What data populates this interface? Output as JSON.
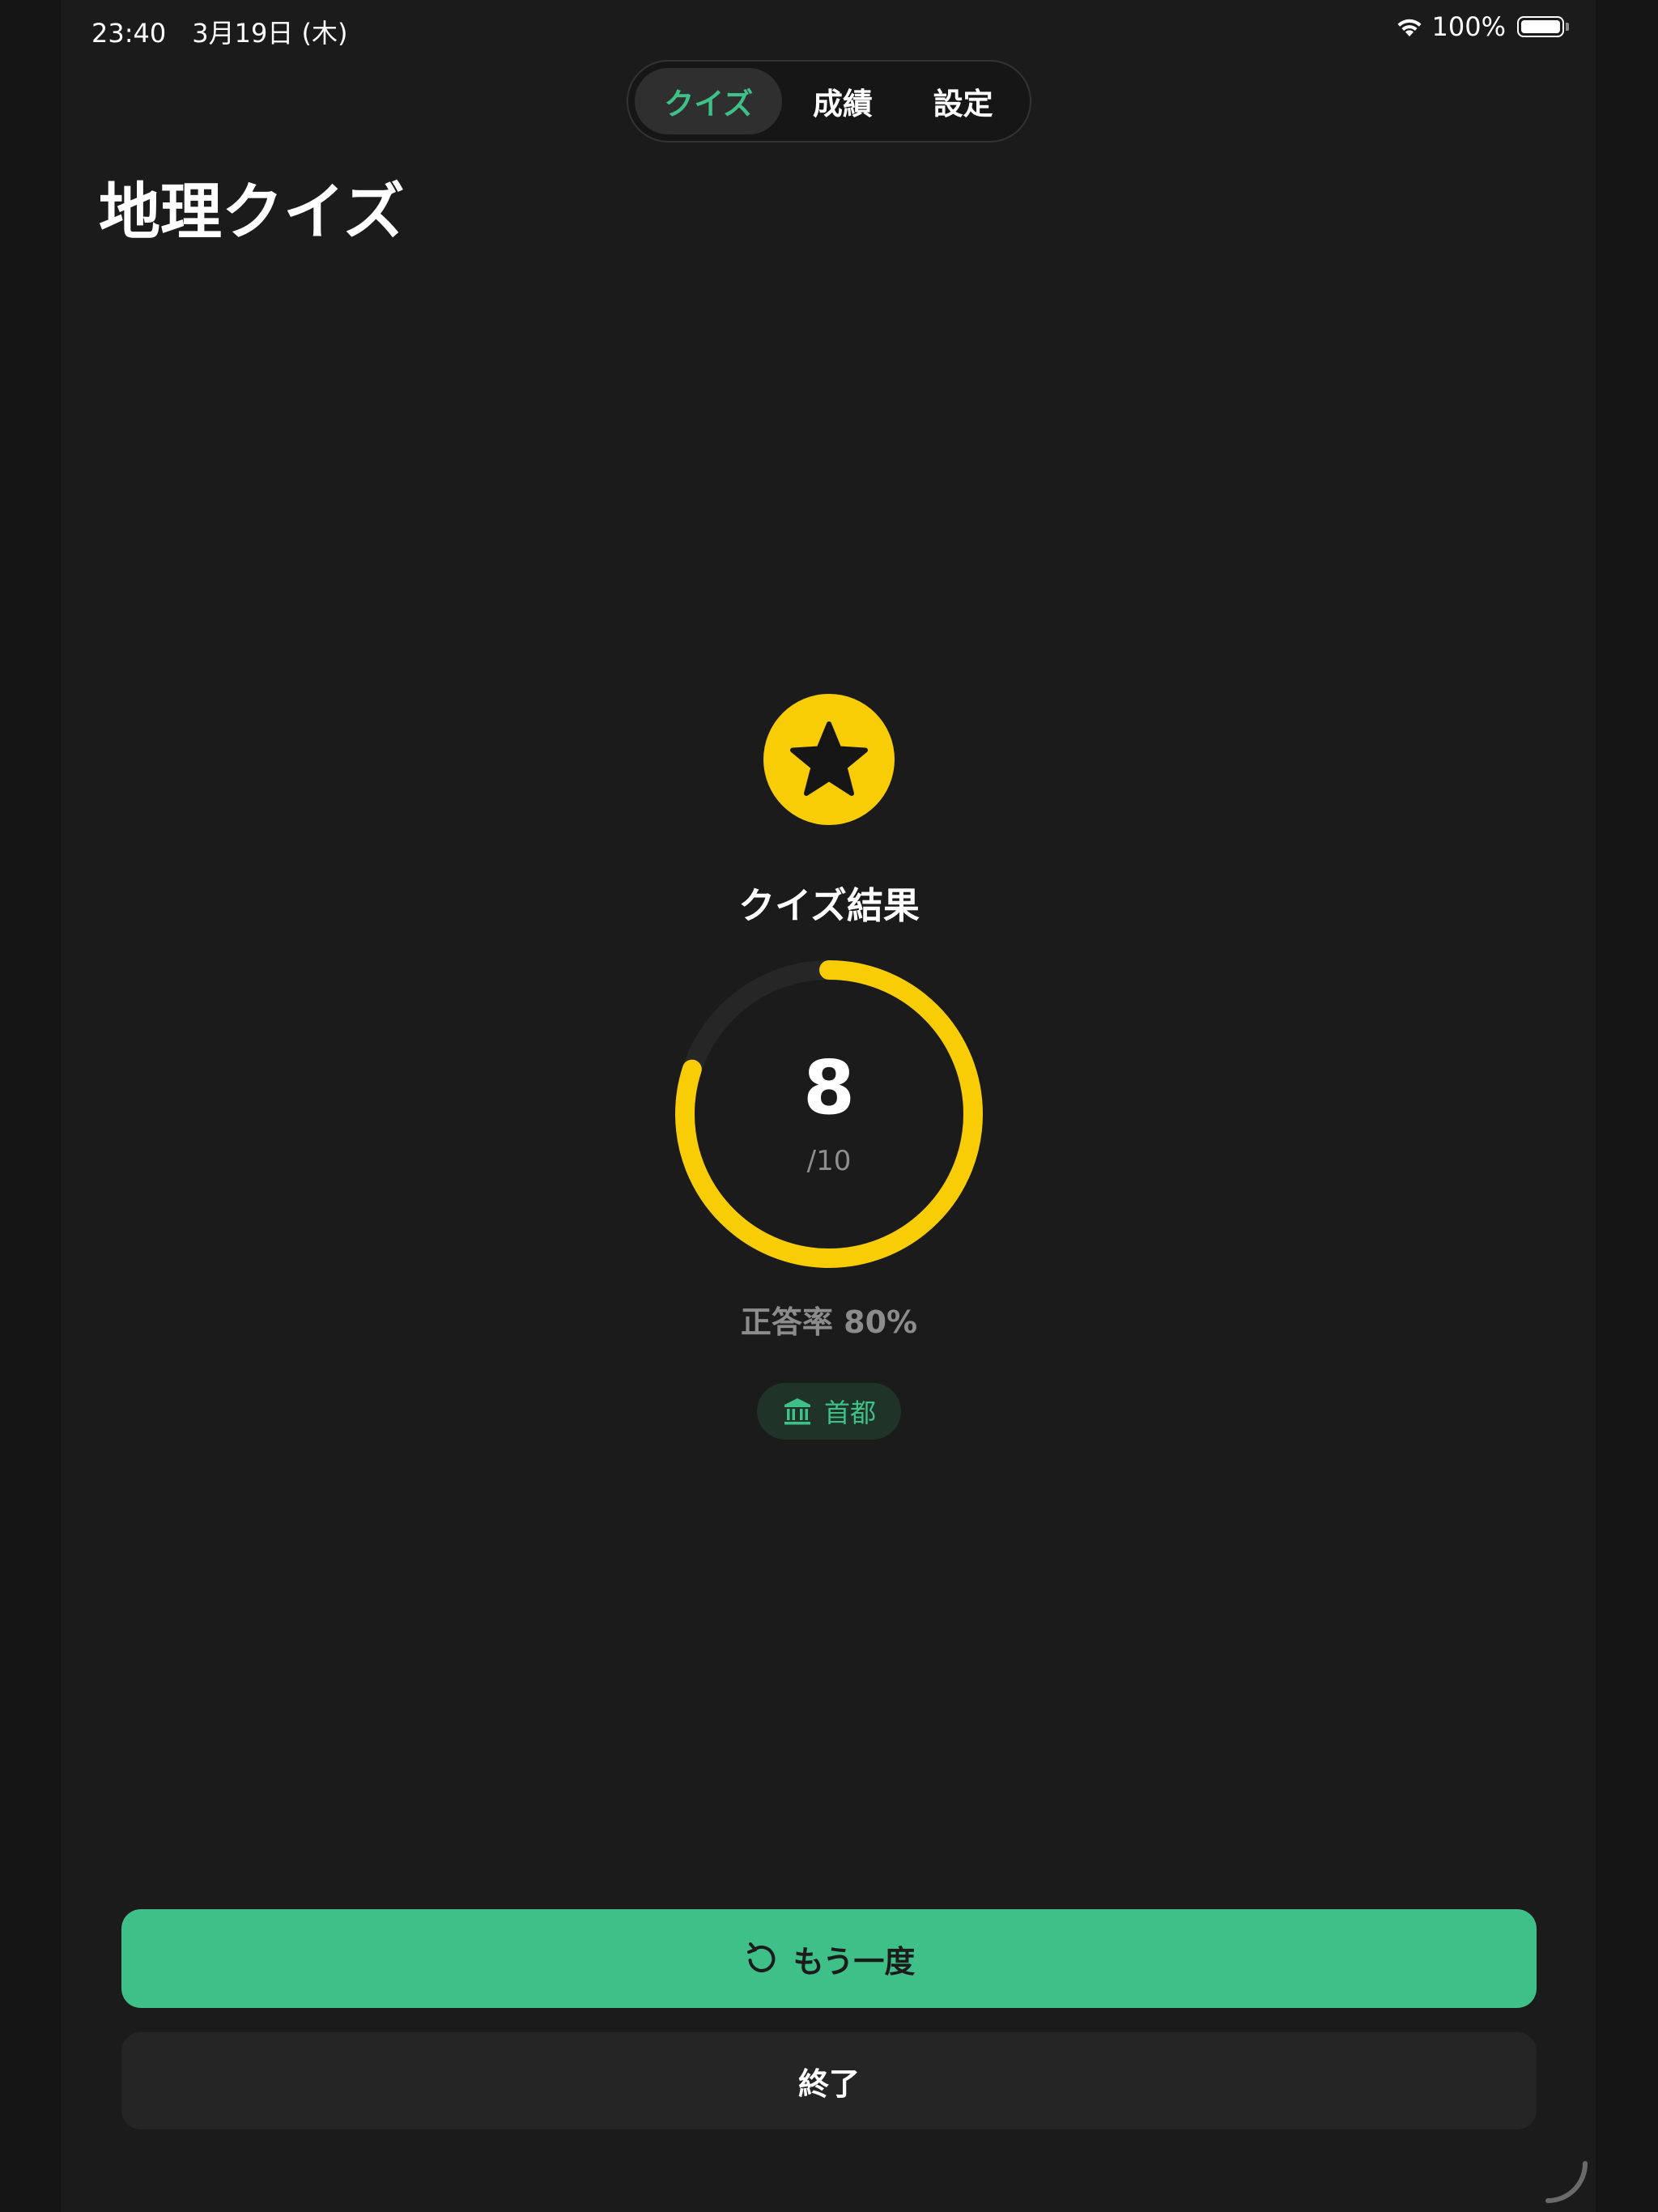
{
  "status_bar": {
    "time_date": "23:40　3月19日 (木)",
    "battery_text": "100%",
    "battery_level": 1.0
  },
  "tabs": [
    {
      "label": "クイズ",
      "selected": true
    },
    {
      "label": "成績",
      "selected": false
    },
    {
      "label": "設定",
      "selected": false
    }
  ],
  "page_title": "地理クイズ",
  "result": {
    "title": "クイズ結果",
    "score": "8",
    "total": "/10",
    "score_fraction": 0.8,
    "accuracy": "正答率 80%",
    "category": "首都"
  },
  "buttons": {
    "retry_label": "もう一度",
    "end_label": "終了"
  },
  "colors": {
    "accent_green": "#40c089",
    "score_yellow": "#f8cd06",
    "background": "#1b1b1b"
  },
  "icons": {
    "star": "star-icon",
    "category": "bank-icon",
    "retry": "arrow-counterclockwise-icon",
    "wifi": "wifi-icon",
    "battery": "battery-icon"
  }
}
